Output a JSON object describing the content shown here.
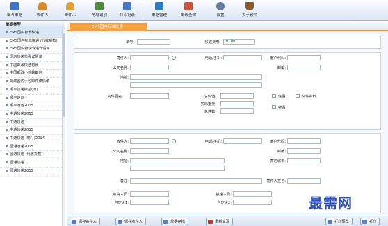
{
  "toolbar": {
    "items": [
      {
        "label": "填写单据",
        "icon": "form-icon",
        "color": "#3d73c9"
      },
      {
        "label": "收件人",
        "icon": "person-icon",
        "color": "#d9892b"
      },
      {
        "label": "寄件人",
        "icon": "person-icon",
        "color": "#e0a13a"
      },
      {
        "label": "地址识别",
        "icon": "address-card-icon",
        "color": "#4d8c3a"
      },
      {
        "label": "打印记录",
        "icon": "print-record-icon",
        "color": "#4a78c4"
      },
      {
        "label": "单据管理",
        "icon": "document-manage-icon",
        "color": "#2e7bbf"
      },
      {
        "label": "邮编查询",
        "icon": "postcode-search-icon",
        "color": "#c8553d"
      },
      {
        "label": "设置",
        "icon": "gear-icon",
        "color": "#6b7d9c"
      },
      {
        "label": "关于软件",
        "icon": "coffee-icon",
        "color": "#8a5a2b"
      }
    ]
  },
  "sidebar": {
    "header": "单据类型",
    "items": [
      {
        "label": "EMS国内标准快递"
      },
      {
        "label": "EMS国内标准快递 (代收货款)"
      },
      {
        "label": "EMS国内特快专递详情单"
      },
      {
        "label": "国内快递包裹详情单"
      },
      {
        "label": "中国邮政快递包裹"
      },
      {
        "label": "中国邮政小蓝鲸邮包"
      },
      {
        "label": "邮政国内小包邮件详情单"
      },
      {
        "label": "顺丰快递标签(旧)"
      },
      {
        "label": "顺丰速运"
      },
      {
        "label": "顺丰速运2015"
      },
      {
        "label": "申通快递2015"
      },
      {
        "label": "中通快递"
      },
      {
        "label": "中通快递2015"
      },
      {
        "label": "中通快递 (制打)2014"
      },
      {
        "label": "圆通速递2015"
      },
      {
        "label": "圆通快递 (代收货款)"
      },
      {
        "label": "圆通快递"
      },
      {
        "label": "圆通快递2015"
      }
    ]
  },
  "main": {
    "tab_label": "EMS国内标准快递",
    "order": {
      "number_label": "单号:",
      "number_value": "",
      "fee_label": "快递费用:",
      "fee_value": "10.00"
    },
    "sender": {
      "name_label": "寄件人:",
      "phone_label": "电话/手机:",
      "customer_code_label": "客户代码:",
      "company_label": "公司名称:",
      "postcode_label": "邮编:",
      "address_label": "地址:"
    },
    "item": {
      "name_label": "内件品名:",
      "total_value_label": "总价值:",
      "actual_weight_label": "实际重量:",
      "total_pieces_label": "总件数:",
      "option_letter": "信函",
      "option_doc": "文件资料",
      "option_goods": "物品"
    },
    "receiver": {
      "name_label": "收件人:",
      "phone_label": "电话/手机:",
      "customer_code_label": "客户代码:",
      "company_label": "公司名称:",
      "postcode_label": "邮编:",
      "address_label": "地址:",
      "dest_city_label": "寄达城市:",
      "remark_label": "备注:",
      "receiver_sign_label": "寄件人签名:"
    },
    "staff": {
      "collector_label": "收寄人员:",
      "delivery_label": "投递人员:",
      "custom1_label": "自定义1:",
      "custom2_label": "自定义2:"
    }
  },
  "bottom": {
    "save_sender": "保存寄件人",
    "save_receiver": "保存收件人",
    "save_order": "单据存档",
    "reset": "重新填写",
    "print_preview": "打印预览",
    "print": "打印"
  },
  "watermark": "最需网",
  "colors": {
    "accent": "#ef8f2d",
    "tab": "#f3a042",
    "fee_text": "#197b1b"
  }
}
